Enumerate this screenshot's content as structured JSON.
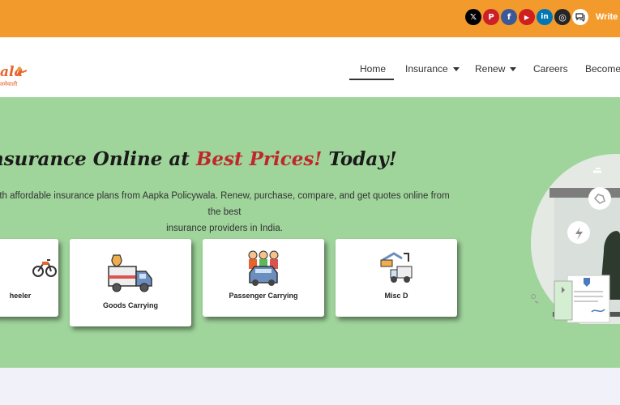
{
  "topbar": {
    "socials": [
      {
        "name": "x-icon",
        "glyph": "𝕏",
        "color": "#000000"
      },
      {
        "name": "pinterest-icon",
        "glyph": "P",
        "color": "#cb2027"
      },
      {
        "name": "facebook-icon",
        "glyph": "f",
        "color": "#3b5998"
      },
      {
        "name": "youtube-icon",
        "glyph": "▶",
        "color": "#cd201f"
      },
      {
        "name": "linkedin-icon",
        "glyph": "in",
        "color": "#0077b5"
      },
      {
        "name": "instagram-icon",
        "glyph": "◎",
        "color": "#262626"
      },
      {
        "name": "chat-icon",
        "glyph": "💬",
        "color": "#ffffff"
      }
    ],
    "write_label": "Write a"
  },
  "logo": {
    "main": "ala",
    "sub": "लमेवाली"
  },
  "nav": {
    "home": "Home",
    "insurance": "Insurance",
    "renew": "Renew",
    "careers": "Careers",
    "become": "Become"
  },
  "hero": {
    "headline_pre": "nsurance Online at ",
    "headline_red": "Best Prices!",
    "headline_post": " Today!",
    "sub_line1": "th affordable insurance plans from Aapka Policywala. Renew, purchase, compare, and get quotes online from the best",
    "sub_line2": "insurance providers in India.",
    "cards": [
      {
        "label": "heeler"
      },
      {
        "label": "Goods Carrying"
      },
      {
        "label": "Passenger Carrying"
      },
      {
        "label": "Misc D"
      }
    ]
  },
  "colors": {
    "topbar": "#f39a2c",
    "hero": "#9fd49b",
    "accent_red": "#c0272d"
  }
}
